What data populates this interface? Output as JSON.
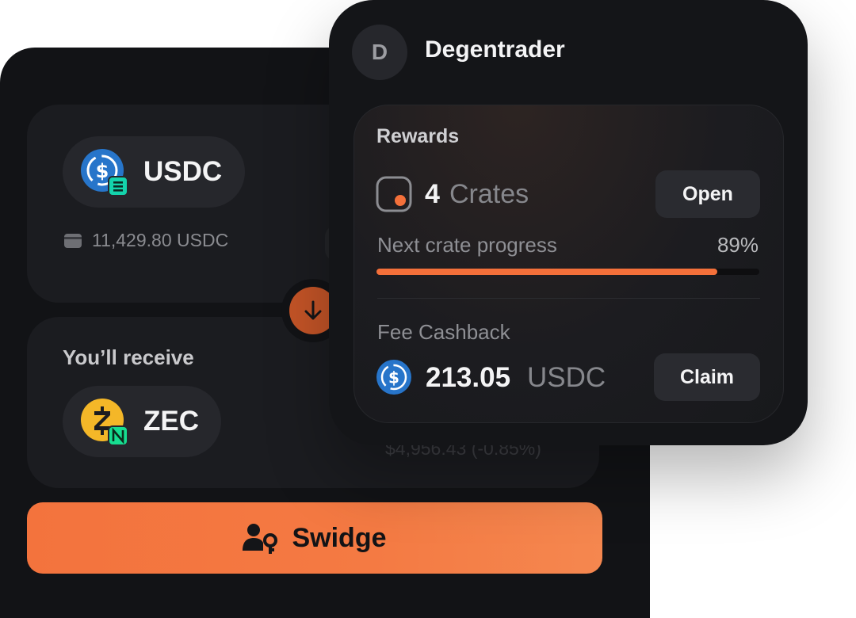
{
  "swap": {
    "from_token": "USDC",
    "from_balance": "11,429.80 USDC",
    "receive_label": "You’ll receive",
    "to_token": "ZEC",
    "to_usd_value": "$4,956.43 (-0.85%)",
    "action_label": "Swidge"
  },
  "profile": {
    "avatar_initial": "D",
    "username": "Degentrader"
  },
  "rewards": {
    "title": "Rewards",
    "crates_count": "4",
    "crates_label": "Crates",
    "open_label": "Open",
    "progress_label": "Next crate progress",
    "progress_text": "89%",
    "progress_value": 0.89,
    "fee_cashback_label": "Fee Cashback",
    "cashback_amount": "213.05",
    "cashback_unit": "USDC",
    "claim_label": "Claim"
  },
  "colors": {
    "accent": "#f4703a",
    "panel": "#121316",
    "card": "#1b1c20",
    "usdc_blue": "#2775ca",
    "zec_yellow": "#f4b728"
  },
  "icons": {
    "from_token": "usdc-icon",
    "from_chain": "solana-icon",
    "to_token": "zec-icon",
    "to_chain": "near-icon",
    "balance": "wallet-icon",
    "swap_direction": "arrow-down-icon",
    "action": "user-key-icon",
    "crate": "crate-icon",
    "cashback": "usdc-icon"
  }
}
